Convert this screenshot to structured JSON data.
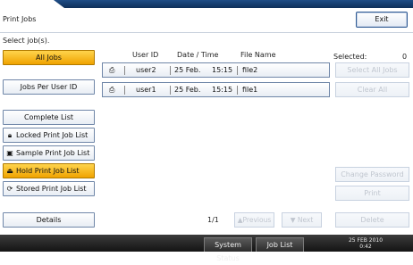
{
  "window": {
    "title": "Print Jobs",
    "exit_label": "Exit"
  },
  "left_panel": {
    "select_label": "Select job(s).",
    "all_jobs": "All Jobs",
    "jobs_per_user": "Jobs Per User ID",
    "complete_list": "Complete List",
    "locked_list": "Locked Print Job List",
    "sample_list": "Sample Print Job List",
    "hold_list": "Hold Print Job List",
    "stored_list": "Stored Print Job List",
    "details": "Details"
  },
  "table": {
    "headers": {
      "user": "User ID",
      "datetime": "Date / Time",
      "file": "File Name"
    },
    "rows": [
      {
        "user": "user2",
        "date": "25 Feb.",
        "time": "15:15",
        "file": "file2"
      },
      {
        "user": "user1",
        "date": "25 Feb.",
        "time": "15:15",
        "file": "file1"
      }
    ]
  },
  "right_panel": {
    "selected_label": "Selected:",
    "selected_count": "0",
    "select_all": "Select All Jobs",
    "clear_all": "Clear All",
    "change_password": "Change Password",
    "print": "Print",
    "delete": "Delete"
  },
  "pagination": {
    "indicator": "1/1",
    "previous": "▲Previous",
    "next": "▼ Next"
  },
  "status_bar": {
    "system_status": "System Status",
    "job_list": "Job List",
    "date": "25 FEB  2010",
    "time": "0:42"
  }
}
